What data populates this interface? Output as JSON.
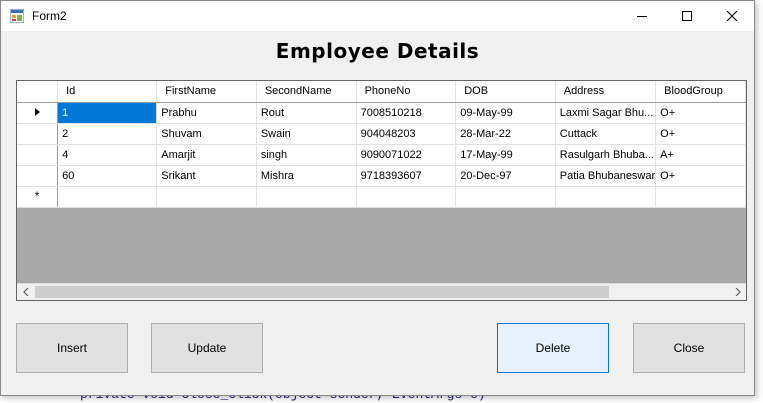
{
  "window": {
    "title": "Form2",
    "controls": {
      "minimize": "minimize",
      "maximize": "maximize",
      "close": "close"
    }
  },
  "form": {
    "heading": "Employee Details"
  },
  "grid": {
    "columns": [
      "Id",
      "FirstName",
      "SecondName",
      "PhoneNo",
      "DOB",
      "Address",
      "BloodGroup"
    ],
    "rows": [
      {
        "id": "1",
        "first": "Prabhu",
        "second": "Rout",
        "phone": "7008510218",
        "dob": "09-May-99",
        "address": "Laxmi Sagar Bhu...",
        "blood": "O+",
        "current": true
      },
      {
        "id": "2",
        "first": "Shuvam",
        "second": "Swain",
        "phone": "904048203",
        "dob": "28-Mar-22",
        "address": "Cuttack",
        "blood": "O+"
      },
      {
        "id": "4",
        "first": "Amarjit",
        "second": "singh",
        "phone": "9090071022",
        "dob": "17-May-99",
        "address": "Rasulgarh Bhuba...",
        "blood": "A+"
      },
      {
        "id": "60",
        "first": "Srikant",
        "second": "Mishra",
        "phone": "9718393607",
        "dob": "20-Dec-97",
        "address": "Patia Bhubaneswar",
        "blood": "O+"
      }
    ],
    "new_row_marker": "*"
  },
  "buttons": {
    "insert": "Insert",
    "update": "Update",
    "delete": "Delete",
    "close": "Close"
  },
  "background_code": "private void Close_Click(object sender, EventArgs e)",
  "colors": {
    "selection": "#0078d7",
    "focused_button_bg": "#e5f1fb",
    "focused_button_border": "#0078d7",
    "grid_empty_area": "#a9a9a9"
  }
}
